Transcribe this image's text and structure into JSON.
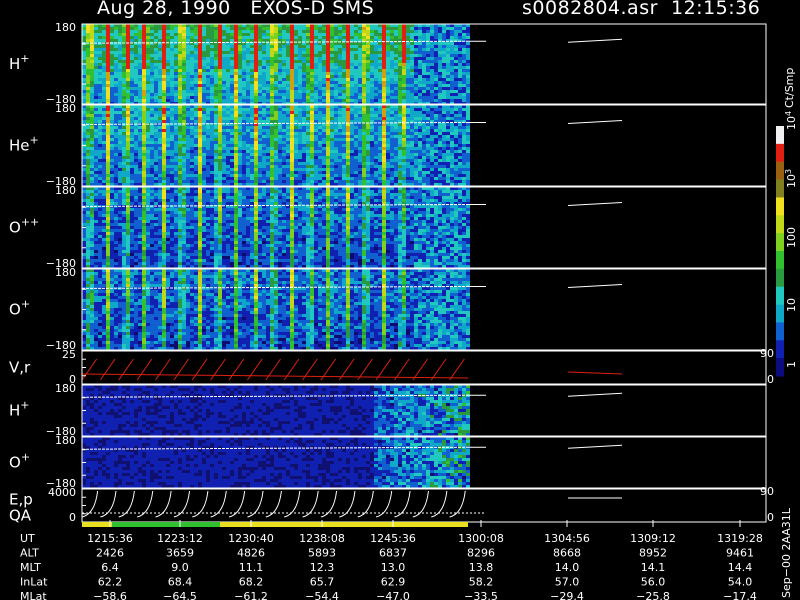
{
  "header": {
    "title_left": "Aug 28, 1990   EXOS-D SMS",
    "title_right": "s0082804.asr  12:15:36"
  },
  "chart_data": {
    "type": "heatmap",
    "panels": [
      {
        "label": "H",
        "sup": "+",
        "ymax": "180",
        "ymin": "−180",
        "kind": "spectro",
        "style": "strong"
      },
      {
        "label": "He",
        "sup": "+",
        "ymax": "180",
        "ymin": "−180",
        "kind": "spectro",
        "style": "medium"
      },
      {
        "label": "O",
        "sup": "++",
        "ymax": "180",
        "ymin": "−180",
        "kind": "spectro",
        "style": "weak"
      },
      {
        "label": "O",
        "sup": "+",
        "ymax": "180",
        "ymin": "−180",
        "kind": "spectro",
        "style": "weak"
      },
      {
        "label": "V,r",
        "sup": "",
        "ymax": "25",
        "ymin": "0",
        "kind": "line",
        "rmax": "90",
        "rmin": "0"
      },
      {
        "label": "H",
        "sup": "+",
        "ymax": "180",
        "ymin": "−180",
        "kind": "spectro",
        "style": "faint"
      },
      {
        "label": "O",
        "sup": "+",
        "ymax": "180",
        "ymin": "−180",
        "kind": "spectro",
        "style": "faint"
      },
      {
        "label": "E,p",
        "sup": "",
        "label2": "QA",
        "ymax": "4000",
        "ymin": "0",
        "kind": "line",
        "rmax": "90",
        "rmin": "0"
      }
    ],
    "colorbar": {
      "title": "Ct/Smp",
      "ticks": [
        "1",
        "10",
        "100",
        "10",
        "10"
      ],
      "tick_sups": [
        "",
        "",
        "",
        "3",
        "4"
      ],
      "colors": [
        "#0c0c80",
        "#1020b0",
        "#1060d0",
        "#10a8c8",
        "#20c8c0",
        "#2a9a40",
        "#30c030",
        "#80d020",
        "#c0d818",
        "#f0e020",
        "#808020",
        "#986010",
        "#e02010",
        "#f0f0f0"
      ]
    },
    "table": {
      "row_labels": [
        "UT",
        "ALT",
        "MLT",
        "InLat",
        "MLat"
      ],
      "columns": [
        [
          "1215:36",
          "2426",
          "6.4",
          "62.2",
          "−58.6"
        ],
        [
          "1223:12",
          "3659",
          "9.0",
          "68.4",
          "−64.5"
        ],
        [
          "1230:40",
          "4826",
          "11.1",
          "68.2",
          "−61.2"
        ],
        [
          "1238:08",
          "5893",
          "12.3",
          "65.7",
          "−54.4"
        ],
        [
          "1245:36",
          "6837",
          "13.0",
          "62.9",
          "−47.0"
        ],
        [
          "1300:08",
          "8296",
          "13.8",
          "58.2",
          "−33.5"
        ],
        [
          "1304:56",
          "8668",
          "14.0",
          "57.0",
          "−29.4"
        ],
        [
          "1309:12",
          "8952",
          "14.1",
          "56.0",
          "−25.8"
        ],
        [
          "1319:28",
          "9461",
          "14.4",
          "54.0",
          "−17.4"
        ]
      ]
    },
    "footer_note": "Sep−00 2AA31L"
  }
}
